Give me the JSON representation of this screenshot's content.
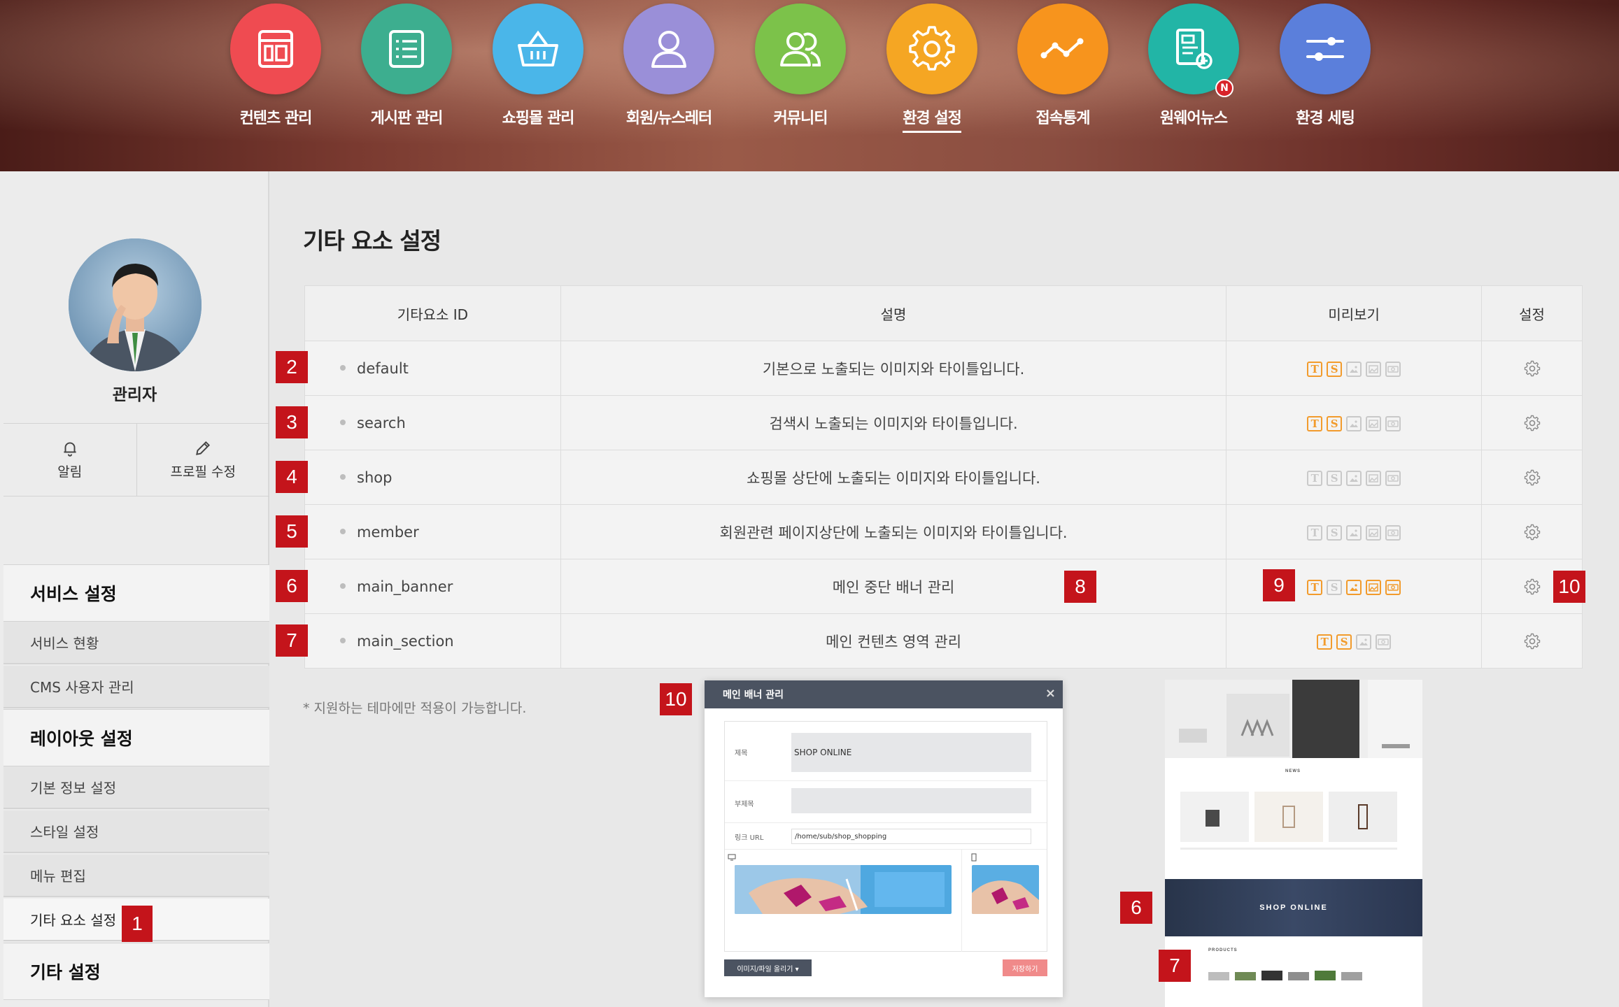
{
  "nav": {
    "items": [
      {
        "label": "컨텐츠 관리",
        "icon": "content-layout-icon",
        "color": "#ef4b51"
      },
      {
        "label": "게시판 관리",
        "icon": "board-list-icon",
        "color": "#3dae8f"
      },
      {
        "label": "쇼핑몰 관리",
        "icon": "shopping-basket-icon",
        "color": "#4ab6e9"
      },
      {
        "label": "회원/뉴스레터",
        "icon": "member-user-icon",
        "color": "#9a8fd8"
      },
      {
        "label": "커뮤니티",
        "icon": "community-users-icon",
        "color": "#7cc24a"
      },
      {
        "label": "환경 설정",
        "icon": "settings-gear-icon",
        "color": "#f5a623",
        "active": true
      },
      {
        "label": "접속통계",
        "icon": "statistics-line-icon",
        "color": "#f7941d"
      },
      {
        "label": "원웨어뉴스",
        "icon": "news-document-icon",
        "color": "#22b5a6",
        "badge": "N"
      },
      {
        "label": "환경 세팅",
        "icon": "sliders-icon",
        "color": "#5b7fdb"
      }
    ]
  },
  "sidebar": {
    "admin_name": "관리자",
    "actions": [
      {
        "label": "알림",
        "icon": "bell-icon"
      },
      {
        "label": "프로필 수정",
        "icon": "pencil-icon"
      }
    ],
    "sections": {
      "service": {
        "title": "서비스 설정",
        "items": [
          "서비스 현황",
          "CMS 사용자 관리"
        ]
      },
      "layout": {
        "title": "레이아웃 설정",
        "items": [
          "기본 정보 설정",
          "스타일 설정",
          "메뉴 편집",
          "기타 요소 설정"
        ]
      },
      "other": {
        "title": "기타 설정"
      }
    }
  },
  "main": {
    "title": "기타 요소 설정",
    "table": {
      "headers": [
        "기타요소 ID",
        "설명",
        "미리보기",
        "설정"
      ],
      "rows": [
        {
          "id": "default",
          "desc": "기본으로 노출되는 이미지와 타이틀입니다.",
          "preview": [
            true,
            true,
            false,
            false,
            false
          ]
        },
        {
          "id": "search",
          "desc": "검색시 노출되는 이미지와 타이틀입니다.",
          "preview": [
            true,
            true,
            false,
            false,
            false
          ]
        },
        {
          "id": "shop",
          "desc": "쇼핑몰 상단에 노출되는 이미지와 타이틀입니다.",
          "preview": [
            false,
            false,
            false,
            false,
            false
          ]
        },
        {
          "id": "member",
          "desc": "회원관련 페이지상단에 노출되는 이미지와 타이틀입니다.",
          "preview": [
            false,
            false,
            false,
            false,
            false
          ]
        },
        {
          "id": "main_banner",
          "desc": "메인 중단 배너 관리",
          "preview": [
            true,
            false,
            true,
            true,
            true
          ]
        },
        {
          "id": "main_section",
          "desc": "메인 컨텐츠 영역 관리",
          "preview": [
            true,
            true,
            false,
            false
          ]
        }
      ]
    },
    "footnote": "* 지원하는 테마에만 적용이 가능합니다."
  },
  "markers": [
    "1",
    "2",
    "3",
    "4",
    "5",
    "6",
    "7",
    "8",
    "9",
    "10",
    "10",
    "6",
    "7"
  ],
  "dialog": {
    "title": "메인 배너 관리",
    "close": "×",
    "fields": {
      "title_label": "제목",
      "title_value": "SHOP ONLINE",
      "subtitle_label": "부제목",
      "subtitle_value": "",
      "link_label": "링크 URL",
      "link_value": "/home/sub/shop_shopping"
    },
    "upload_button": "이미지/파일 올리기 ▾",
    "save_button": "저장하기"
  },
  "site_preview": {
    "news_heading": "NEWS",
    "banner_text": "SHOP ONLINE",
    "products_heading": "PRODUCTS"
  }
}
